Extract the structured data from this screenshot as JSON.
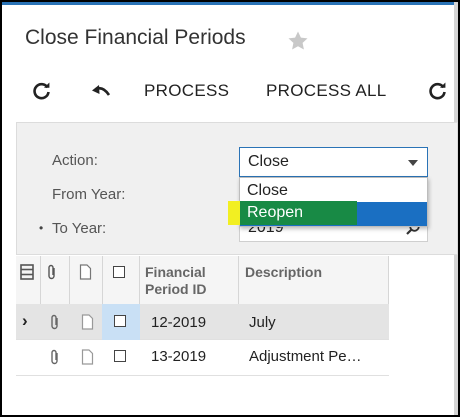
{
  "page": {
    "title": "Close Financial Periods"
  },
  "toolbar": {
    "refresh_icon": "refresh-icon",
    "undo_icon": "undo-icon",
    "process_label": "PROCESS",
    "process_all_label": "PROCESS ALL",
    "schedule_icon": "schedule-icon"
  },
  "filter": {
    "action_label": "Action:",
    "action_value": "Close",
    "from_year_label": "From Year:",
    "to_year_label": "To Year:",
    "to_year_value": "2019",
    "required_marker": "•"
  },
  "action_options": [
    {
      "label": "Close"
    },
    {
      "label": "Reopen"
    }
  ],
  "grid": {
    "headers": {
      "period_line1": "Financial",
      "period_line2": "Period ID",
      "description": "Description"
    },
    "rows": [
      {
        "period": "12-2019",
        "description": "July",
        "current": true
      },
      {
        "period": "13-2019",
        "description": "Adjustment Pe…",
        "current": false
      }
    ],
    "row_indicator": "›"
  },
  "colors": {
    "accent": "#2a73b6",
    "option_highlight": "#1a6fc2",
    "annotation_yellow": "#f2ef22",
    "annotation_green": "#188a45"
  }
}
